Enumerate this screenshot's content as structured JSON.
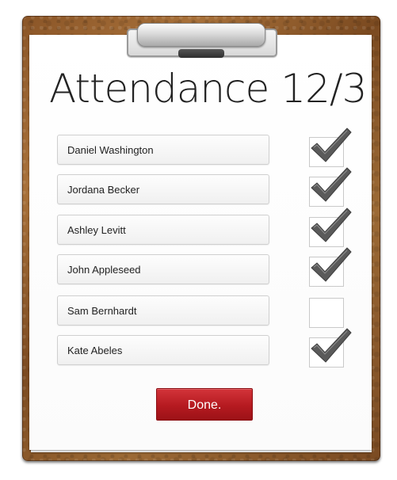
{
  "title": "Attendance 12/3",
  "students": [
    {
      "name": "Daniel Washington",
      "present": true
    },
    {
      "name": "Jordana Becker",
      "present": true
    },
    {
      "name": "Ashley Levitt",
      "present": true
    },
    {
      "name": "John Appleseed",
      "present": true
    },
    {
      "name": "Sam Bernhardt",
      "present": false
    },
    {
      "name": "Kate Abeles",
      "present": true
    }
  ],
  "done_label": "Done.",
  "colors": {
    "board": "#8a5527",
    "done_button": "#b51a20",
    "check": "#555555"
  },
  "icons": {
    "check": "checkmark-icon"
  }
}
